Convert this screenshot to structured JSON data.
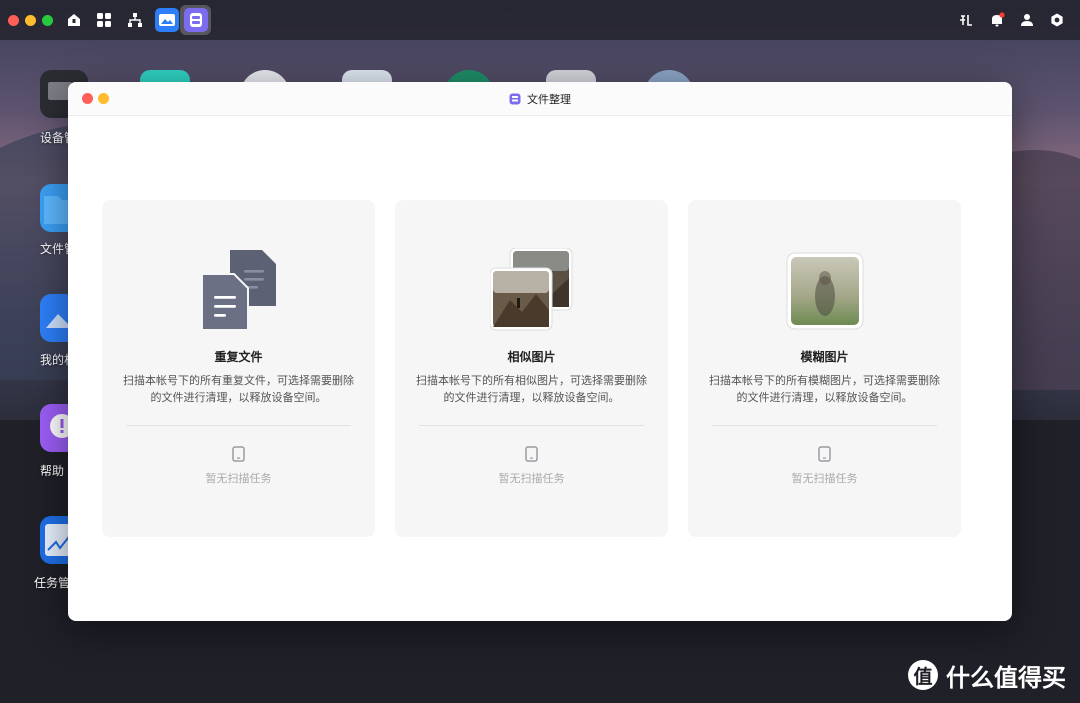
{
  "desktop": {
    "icons": [
      {
        "label": "设备管"
      },
      {
        "label": "文件管"
      },
      {
        "label": "我的相"
      },
      {
        "label": "帮助"
      },
      {
        "label": "任务管"
      }
    ]
  },
  "window": {
    "title": "文件整理",
    "cards": [
      {
        "title": "重复文件",
        "description": "扫描本帐号下的所有重复文件，可选择需要删除的文件进行清理，以释放设备空间。",
        "status": "暂无扫描任务"
      },
      {
        "title": "相似图片",
        "description": "扫描本帐号下的所有相似图片，可选择需要删除的文件进行清理，以释放设备空间。",
        "status": "暂无扫描任务"
      },
      {
        "title": "模糊图片",
        "description": "扫描本帐号下的所有模糊图片，可选择需要删除的文件进行清理，以释放设备空间。",
        "status": "暂无扫描任务"
      }
    ]
  },
  "watermark": {
    "icon_text": "值",
    "text": "什么值得买"
  },
  "colors": {
    "close": "#ff5f57",
    "minimize": "#febc2e",
    "zoom": "#28c840",
    "app_accent": "#6b5ce7"
  }
}
